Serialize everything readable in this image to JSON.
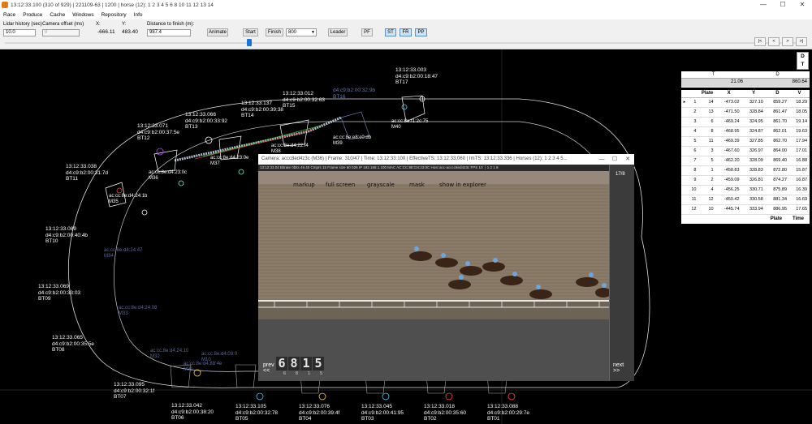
{
  "window": {
    "title": "13:12:33.100 (310 of 929) | 221109-63 | 1200 | horse (12): 1 2 3 4 5 6 8 10 11 12 13 14",
    "controls": [
      "—",
      "☐",
      "✕"
    ]
  },
  "menu": [
    "Race",
    "Produce",
    "Cache",
    "Windows",
    "Repository",
    "Info"
  ],
  "toolbar": {
    "lidar_history_label": "Lidar history (sec)",
    "lidar_history_value": "10.0",
    "camera_offset_label": "Camera offset (ms)",
    "camera_offset_value": "0",
    "x_label": "X:",
    "x_value": "-666.11",
    "y_label": "Y:",
    "y_value": "483.40",
    "distance_label": "Distance to finish (m):",
    "distance_value": "987.4",
    "animate": "Animate",
    "start": "Start",
    "finish": "Finish",
    "speed_select": "800",
    "leader": "Leader",
    "pf": "PF",
    "st": "ST",
    "fr": "FR",
    "pp": "PP",
    "slider_position": 0.305,
    "nav": [
      "|<",
      "<",
      ">",
      ">|"
    ]
  },
  "stations": [
    {
      "time": "13:12:33.003",
      "mac": "d4:c9:b2:00:18:47",
      "id": "BT17"
    },
    {
      "time": "",
      "mac": "d4:c9:b2:00:32:9b",
      "id": "BT16"
    },
    {
      "time": "13:12:33.012",
      "mac": "d4:c9:b2:00:32:63",
      "id": "BT15"
    },
    {
      "time": "13:12:33.137",
      "mac": "d4:c9:b2:00:39:38",
      "id": "BT14"
    },
    {
      "time": "13:12:33.066",
      "mac": "d4:c9:b2:00:33:92",
      "id": "BT13"
    },
    {
      "time": "13:12:33.071",
      "mac": "d4:c9:b2:00:37:5e",
      "id": "BT12"
    },
    {
      "time": "13:12:33.038",
      "mac": "d4:c9:b2:00:31:7d",
      "id": "BT11"
    },
    {
      "time": "13:12:33.089",
      "mac": "d4:c9:b2:00:40:4b",
      "id": "BT10"
    },
    {
      "time": "13:12:33.069",
      "mac": "d4:c9:b2:00:33:03",
      "id": "BT09"
    },
    {
      "time": "13:12:33.065",
      "mac": "d4:c9:b2:00:35:5e",
      "id": "BT08"
    },
    {
      "time": "13:12:33.095",
      "mac": "d4:c9:b2:00:32:1f",
      "id": "BT07"
    },
    {
      "time": "13:12:33.042",
      "mac": "d4:c9:b2:00:38:20",
      "id": "BT06"
    },
    {
      "time": "13:12:33.105",
      "mac": "d4:c9:b2:00:32:78",
      "id": "BT05"
    },
    {
      "time": "13:12:33.076",
      "mac": "d4:c9:b2:00:39:4f",
      "id": "BT04"
    },
    {
      "time": "13:12:33.045",
      "mac": "d4:c9:b2:00:41:95",
      "id": "BT03"
    },
    {
      "time": "13:12:33.018",
      "mac": "d4:c9:b2:00:35:60",
      "id": "BT02"
    },
    {
      "time": "13:12:33.088",
      "mac": "d4:c9:b2:00:29:7e",
      "id": "BT01"
    }
  ],
  "markers": [
    {
      "mac": "ac:cc:8e:f1:2c:75",
      "id": "M40"
    },
    {
      "mac": "ac:cc:8e:e8:c0:db",
      "id": "M39"
    },
    {
      "mac": "ac:cc:8e:d4:22:f4",
      "id": "M38"
    },
    {
      "mac": "ac:cc:8e:d4:23:0e",
      "id": "M37"
    },
    {
      "mac": "ac:cc:8e:d4:23:0c",
      "id": "M36"
    },
    {
      "mac": "ac:cc:8e:d4:24:1b",
      "id": "M35"
    },
    {
      "mac": "ac:cc:8e:d4:24:47",
      "id": "M34"
    },
    {
      "mac": "ac:cc:8e:d4:24:08",
      "id": "M33"
    },
    {
      "mac": "ac:cc:8e:d4:24:10",
      "id": "M32"
    },
    {
      "mac": "ac:cc:8e:d4:88:4e",
      "id": "M31"
    },
    {
      "mac": "ac:cc:8e:d4:09:0",
      "id": "M10"
    }
  ],
  "panel": {
    "dt_button": [
      "D",
      "T"
    ],
    "summary_headers": [
      "T",
      "D"
    ],
    "summary_values": [
      "21.06",
      "860.64"
    ],
    "table_headers": [
      "",
      "",
      "Plate",
      "X",
      "Y",
      "D",
      "V"
    ],
    "rows": [
      [
        "▸",
        "1",
        "14",
        "-473.02",
        "327.10",
        "859.27",
        "18.29"
      ],
      [
        "",
        "2",
        "13",
        "-471.50",
        "328.84",
        "861.47",
        "18.05"
      ],
      [
        "",
        "3",
        "6",
        "-469.24",
        "324.95",
        "861.70",
        "19.14"
      ],
      [
        "",
        "4",
        "8",
        "-468.95",
        "324.87",
        "862.01",
        "19.63"
      ],
      [
        "",
        "5",
        "11",
        "-469.39",
        "327.85",
        "862.70",
        "17.94"
      ],
      [
        "",
        "6",
        "3",
        "-467.60",
        "326.97",
        "864.00",
        "17.01"
      ],
      [
        "",
        "7",
        "5",
        "-462.20",
        "328.09",
        "869.40",
        "16.88"
      ],
      [
        "",
        "8",
        "1",
        "-458.83",
        "328.83",
        "872.80",
        "15.87"
      ],
      [
        "",
        "9",
        "2",
        "-459.09",
        "326.81",
        "874.27",
        "16.87"
      ],
      [
        "",
        "10",
        "4",
        "-456.25",
        "330.71",
        "875.89",
        "16.39"
      ],
      [
        "",
        "11",
        "12",
        "-450.42",
        "330.58",
        "881.34",
        "16.69"
      ],
      [
        "",
        "12",
        "10",
        "-445.74",
        "333.94",
        "886.95",
        "17.65"
      ]
    ],
    "footer": [
      "Plate",
      "Time"
    ]
  },
  "camera": {
    "title": "Camera: accc8ed4z3c (M36) | Frame: 310/47 | Time: 13:12:33:100 | EffectiveTS: 13:12:33.060 | ImTS: 13:12:33.336 | Horses (12): 1 2 3 4 5...",
    "controls": [
      "—",
      "☐",
      "✕"
    ],
    "info": "13:12:33.04 Bitrate 0bits 49.40 Cmprs  15 Frame size  60   026 IP 192.168.1.100 MAC AC:CC:8E:D4:23:0C Host acc-acccc8ed423c FPS 10 ┆ 1 2 1 8",
    "menu": [
      "markup",
      "full screen",
      "grayscale",
      "mask",
      "show in explorer"
    ],
    "counter": "17/8",
    "prev": [
      "prev",
      "<<"
    ],
    "next": [
      "next",
      ">>"
    ],
    "digits": [
      "6",
      "8",
      "1",
      "5"
    ]
  }
}
